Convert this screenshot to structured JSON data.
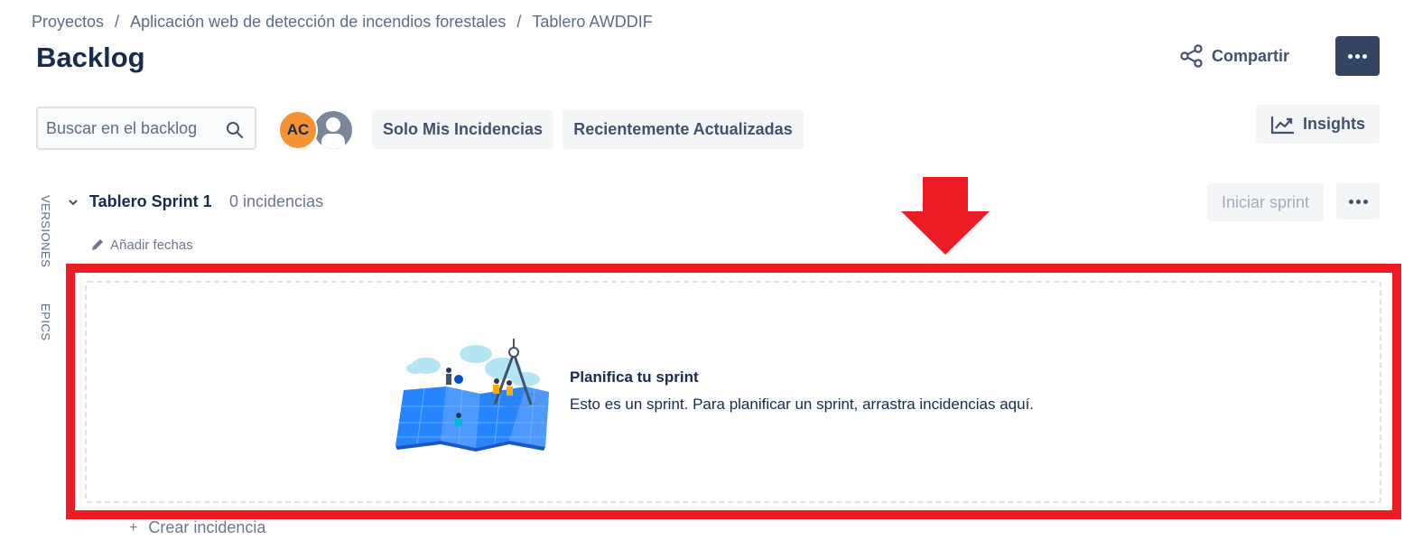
{
  "breadcrumb": {
    "items": [
      "Proyectos",
      "Aplicación web de detección de incendios forestales",
      "Tablero AWDDIF"
    ],
    "separator": "/"
  },
  "header": {
    "title": "Backlog",
    "share_label": "Compartir",
    "share_icon": "share-icon",
    "more_icon": "more-horizontal-icon"
  },
  "toolbar": {
    "search_placeholder": "Buscar en el backlog",
    "search_value": "",
    "avatar_initials": "AC",
    "filters": [
      "Solo Mis Incidencias",
      "Recientemente Actualizadas"
    ],
    "insights_label": "Insights"
  },
  "side_tabs": [
    "VERSIONES",
    "EPICS"
  ],
  "sprint": {
    "name": "Tablero Sprint 1",
    "issue_count": "0 incidencias",
    "add_dates": "Añadir fechas",
    "start_label": "Iniciar sprint",
    "empty_title": "Planifica tu sprint",
    "empty_desc": "Esto es un sprint. Para planificar un sprint, arrastra incidencias aquí.",
    "create_issue": "Crear incidencia"
  },
  "colors": {
    "annotation_red": "#ed1c24",
    "avatar_orange": "#f79232",
    "dark_button": "#344563",
    "text_primary": "#172b4d",
    "text_secondary": "#5e6c84"
  }
}
